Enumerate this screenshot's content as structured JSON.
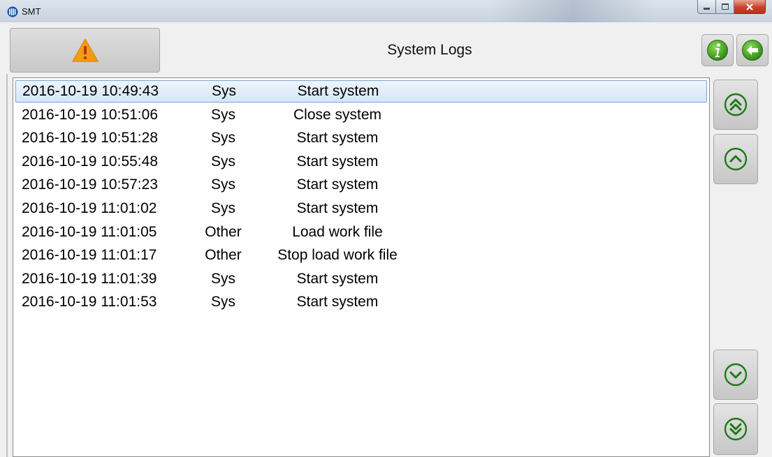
{
  "window": {
    "title": "SMT",
    "logo_icon": "app-logo-icon"
  },
  "window_controls": {
    "minimize_icon": "minimize-icon",
    "maximize_icon": "maximize-icon",
    "close_icon": "close-icon"
  },
  "header": {
    "title": "System Logs",
    "warning_icon": "warning-icon",
    "info_icon": "info-icon",
    "back_icon": "back-arrow-icon"
  },
  "logs": {
    "selected_index": 0,
    "rows": [
      {
        "time": "2016-10-19 10:49:43",
        "type": "Sys",
        "message": "Start system"
      },
      {
        "time": "2016-10-19 10:51:06",
        "type": "Sys",
        "message": "Close system"
      },
      {
        "time": "2016-10-19 10:51:28",
        "type": "Sys",
        "message": "Start system"
      },
      {
        "time": "2016-10-19 10:55:48",
        "type": "Sys",
        "message": "Start system"
      },
      {
        "time": "2016-10-19 10:57:23",
        "type": "Sys",
        "message": "Start system"
      },
      {
        "time": "2016-10-19 11:01:02",
        "type": "Sys",
        "message": "Start system"
      },
      {
        "time": "2016-10-19 11:01:05",
        "type": "Other",
        "message": "Load work file"
      },
      {
        "time": "2016-10-19 11:01:17",
        "type": "Other",
        "message": "Stop load work file"
      },
      {
        "time": "2016-10-19 11:01:39",
        "type": "Sys",
        "message": "Start system"
      },
      {
        "time": "2016-10-19 11:01:53",
        "type": "Sys",
        "message": "Start system"
      }
    ]
  },
  "scroll": {
    "first_icon": "double-chevron-up-icon",
    "up_icon": "chevron-up-icon",
    "down_icon": "chevron-down-icon",
    "last_icon": "double-chevron-down-icon"
  },
  "colors": {
    "accent_green": "#2e9a1c",
    "warning_orange": "#f39c12",
    "selection_border": "#7da2ce",
    "close_red": "#c8422a"
  }
}
